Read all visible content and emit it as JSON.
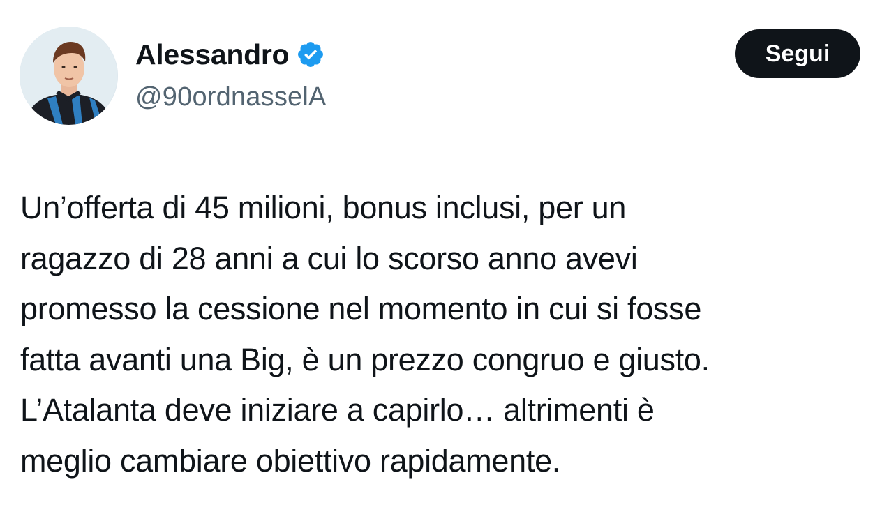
{
  "author": {
    "display_name": "Alessandro",
    "handle": "@90ordnasselA",
    "verified": true,
    "verified_badge_color": "#1d9bf0"
  },
  "actions": {
    "follow_label": "Segui"
  },
  "tweet": {
    "lines": [
      "Un’offerta di 45 milioni, bonus inclusi, per un",
      "ragazzo di 28 anni a cui lo scorso anno avevi",
      "promesso la cessione nel momento in cui si fosse",
      "fatta avanti una Big, è un prezzo congruo e giusto.",
      "L’Atalanta deve iniziare a capirlo… altrimenti è",
      "meglio cambiare obiettivo rapidamente."
    ]
  },
  "icons": {
    "avatar": "user-avatar-icon",
    "verified": "verified-badge-icon"
  },
  "colors": {
    "text_primary": "#0f1419",
    "text_secondary": "#536471",
    "follow_button_bg": "#0f1419",
    "follow_button_text": "#ffffff"
  }
}
